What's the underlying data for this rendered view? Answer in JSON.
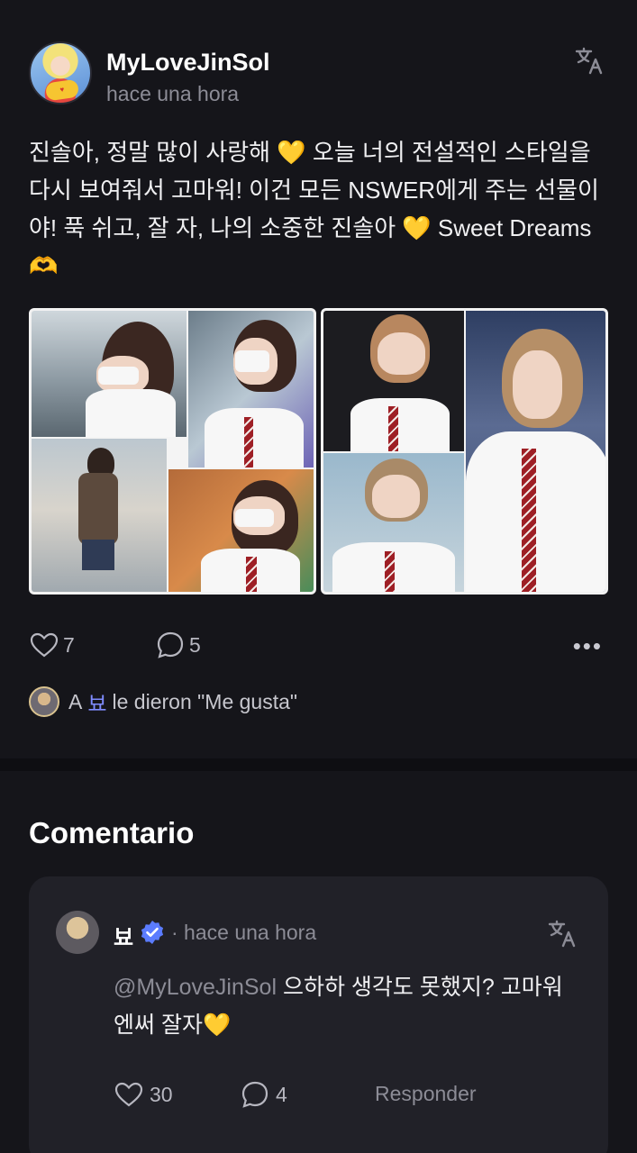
{
  "post": {
    "author": "MyLoveJinSol",
    "time": "hace una hora",
    "text": "진솔아, 정말 많이 사랑해 💛 오늘 너의 전설적인 스타일을 다시 보여줘서 고마워! 이건 모든 NSWER에게 주는 선물이야! 푹 쉬고, 잘 자, 나의 소중한 진솔아 💛 Sweet Dreams 🫶",
    "like_count": "7",
    "comment_count": "5"
  },
  "liked_by": {
    "prefix": "A",
    "user": "뵤",
    "suffix": "le dieron \"Me gusta\""
  },
  "comments_section": {
    "title": "Comentario"
  },
  "comment": {
    "author": "뵤",
    "time": "· hace una hora",
    "mention": "@MyLoveJinSol",
    "text": " 으하하 생각도 못했지? 고마워 엔써 잘자💛",
    "like_count": "30",
    "reply_count": "4",
    "reply_label": "Responder"
  },
  "colors": {
    "background": "#15151a",
    "card": "#212128",
    "accent": "#7f8cff",
    "muted": "#8c8c96"
  },
  "icons": [
    "translate-icon",
    "heart-icon",
    "comment-icon",
    "more-icon",
    "verified-badge-icon"
  ]
}
